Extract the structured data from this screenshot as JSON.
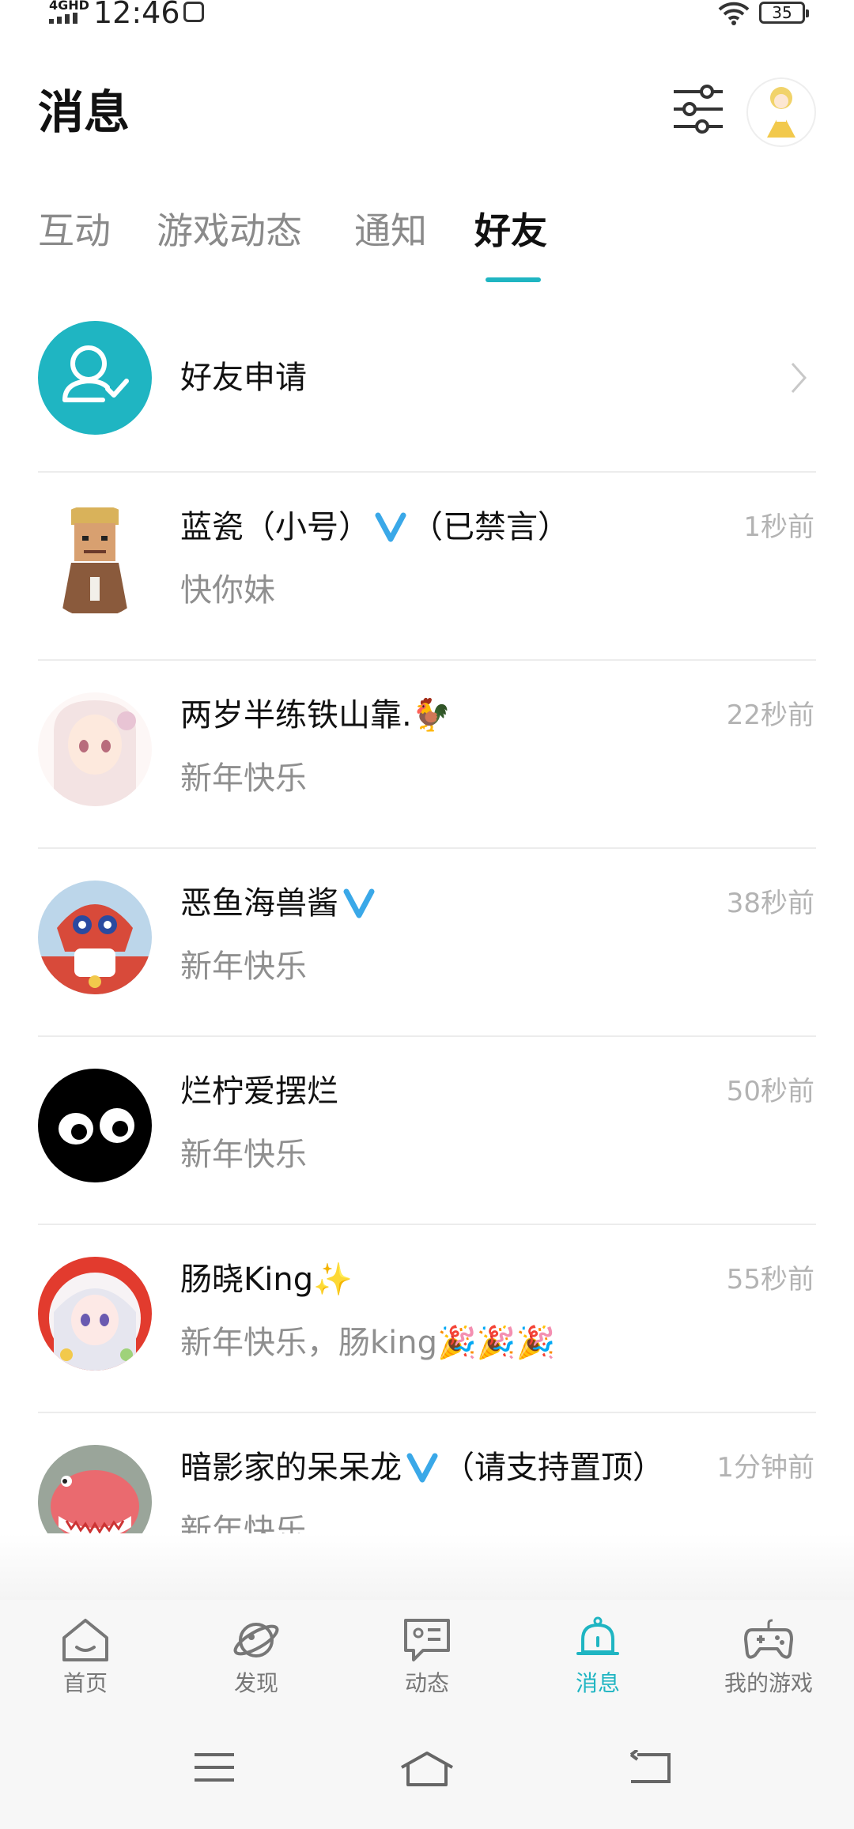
{
  "status_bar": {
    "network": "4GHD",
    "time": "12:46",
    "battery": "35"
  },
  "header": {
    "title": "消息"
  },
  "tabs": [
    {
      "label": "互动"
    },
    {
      "label": "游戏动态"
    },
    {
      "label": "通知"
    },
    {
      "label": "好友"
    }
  ],
  "active_tab": "好友",
  "friend_request": {
    "label": "好友申请"
  },
  "conversations": [
    {
      "name": "蓝瓷（小号）",
      "badge": "verified-v-icon",
      "suffix": "（已禁言）",
      "message": "快你妹",
      "time": "1秒前"
    },
    {
      "name": "两岁半练铁山靠.🐓",
      "suffix": "",
      "message": "新年快乐",
      "time": "22秒前"
    },
    {
      "name": "恶鱼海兽酱",
      "badge": "verified-v-icon",
      "suffix": "",
      "message": "新年快乐",
      "time": "38秒前"
    },
    {
      "name": "烂柠爱摆烂",
      "suffix": "",
      "message": "新年快乐",
      "time": "50秒前"
    },
    {
      "name": "肠晓King✨",
      "suffix": "",
      "message": "新年快乐，肠king🎉🎉🎉",
      "time": "55秒前"
    },
    {
      "name": "暗影家的呆呆龙",
      "badge": "verified-v-icon",
      "suffix": "（请支持置顶）",
      "message": "新年快乐",
      "time": "1分钟前"
    }
  ],
  "bottom_nav": [
    {
      "label": "首页",
      "icon": "home-icon"
    },
    {
      "label": "发现",
      "icon": "planet-icon"
    },
    {
      "label": "动态",
      "icon": "feed-icon"
    },
    {
      "label": "消息",
      "icon": "bell-icon"
    },
    {
      "label": "我的游戏",
      "icon": "gamepad-icon"
    }
  ],
  "colors": {
    "accent": "#1fb5c2",
    "verified": "#3aa8e8",
    "muted": "#8f8f8f",
    "time": "#b3b3b3"
  }
}
